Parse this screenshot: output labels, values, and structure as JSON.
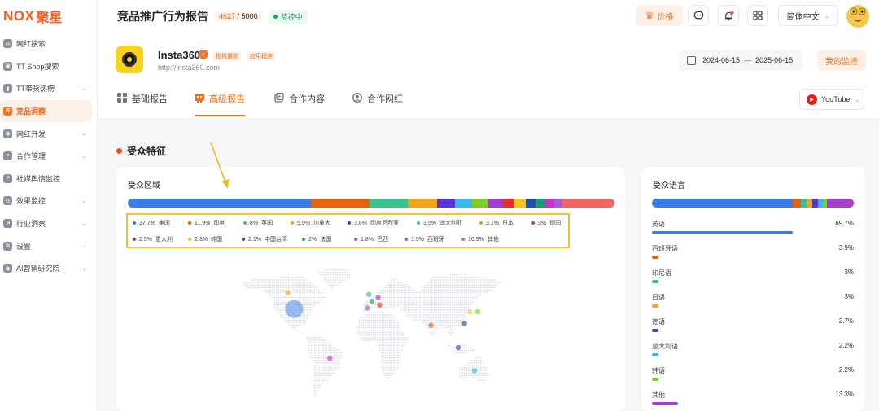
{
  "app": {
    "logo_text": "NOX",
    "logo_cn": "聚星"
  },
  "sidebar": {
    "items": [
      {
        "label": "网红搜索",
        "icon": "compass-icon",
        "chev": false,
        "active": false
      },
      {
        "label": "TT Shop搜索",
        "icon": "shop-icon",
        "chev": false,
        "active": false
      },
      {
        "label": "TT带货热榜",
        "icon": "bar-chart-icon",
        "chev": true,
        "active": false
      },
      {
        "label": "竞品洞察",
        "icon": "insight-icon",
        "chev": false,
        "active": true
      },
      {
        "label": "网红开发",
        "icon": "users-icon",
        "chev": true,
        "active": false
      },
      {
        "label": "合作管理",
        "icon": "document-icon",
        "chev": true,
        "active": false
      },
      {
        "label": "社媒舆情监控",
        "icon": "trend-icon",
        "chev": false,
        "active": false
      },
      {
        "label": "效果监控",
        "icon": "target-icon",
        "chev": true,
        "active": false
      },
      {
        "label": "行业洞察",
        "icon": "analytics-icon",
        "chev": true,
        "active": false
      },
      {
        "label": "设置",
        "icon": "gear-icon",
        "chev": true,
        "active": false
      },
      {
        "label": "AI营销研究院",
        "icon": "ai-icon",
        "chev": true,
        "active": false
      }
    ]
  },
  "header": {
    "title": "竞品推广行为报告",
    "quota_used": "4627",
    "quota_sep": " / ",
    "quota_total": "5000",
    "status": "监控中",
    "price_label": "价格",
    "lang_label": "简体中文"
  },
  "brand": {
    "name": "Insta360",
    "tag1": "相机摄影",
    "tag2": "应用程序",
    "url": "http://insta360.com",
    "date_start": "2024-06-15",
    "date_sep": "—",
    "date_end": "2025-06-15",
    "monitor_label": "我的监控"
  },
  "tabs": [
    {
      "label": "基础报告",
      "active": false
    },
    {
      "label": "高级报告",
      "active": true
    },
    {
      "label": "合作内容",
      "active": false
    },
    {
      "label": "合作网红",
      "active": false
    }
  ],
  "platform_select": "YouTube",
  "section_title": "受众特征",
  "region": {
    "title": "受众区域",
    "items": [
      {
        "pct": "37.7%",
        "name": "美国",
        "value": 37.7,
        "color": "#3b7de8"
      },
      {
        "pct": "11.9%",
        "name": "印度",
        "value": 11.9,
        "color": "#e2620f"
      },
      {
        "pct": "8%",
        "name": "英国",
        "value": 8,
        "color": "#3cc18a"
      },
      {
        "pct": "5.9%",
        "name": "加拿大",
        "value": 5.9,
        "color": "#f3a41f"
      },
      {
        "pct": "3.8%",
        "name": "印度尼西亚",
        "value": 3.8,
        "color": "#5a36d6"
      },
      {
        "pct": "3.5%",
        "name": "澳大利亚",
        "value": 3.5,
        "color": "#3bb7e8"
      },
      {
        "pct": "3.1%",
        "name": "日本",
        "value": 3.1,
        "color": "#7fcb2d"
      },
      {
        "pct": "3%",
        "name": "德国",
        "value": 3,
        "color": "#a63fd0"
      },
      {
        "pct": "2.5%",
        "name": "意大利",
        "value": 2.5,
        "color": "#e3312b"
      },
      {
        "pct": "2.3%",
        "name": "韩国",
        "value": 2.3,
        "color": "#f4c623"
      },
      {
        "pct": "2.1%",
        "name": "中国台湾",
        "value": 2.1,
        "color": "#274fa7"
      },
      {
        "pct": "2%",
        "name": "法国",
        "value": 2,
        "color": "#1c9b7a"
      },
      {
        "pct": "1.8%",
        "name": "巴西",
        "value": 1.8,
        "color": "#c437c1"
      },
      {
        "pct": "1.5%",
        "name": "西班牙",
        "value": 1.5,
        "color": "#9b5ce8"
      },
      {
        "pct": "10.9%",
        "name": "其他",
        "value": 10.9,
        "color": "#f06464"
      }
    ]
  },
  "language": {
    "title": "受众语言",
    "items": [
      {
        "name": "英语",
        "pct": "69.7%",
        "value": 69.7,
        "color": "#3b7de8"
      },
      {
        "name": "西班牙语",
        "pct": "3.9%",
        "value": 3.9,
        "color": "#e2620f"
      },
      {
        "name": "印尼语",
        "pct": "3%",
        "value": 3,
        "color": "#3cc18a"
      },
      {
        "name": "日语",
        "pct": "3%",
        "value": 3,
        "color": "#f3a41f"
      },
      {
        "name": "德语",
        "pct": "2.7%",
        "value": 2.7,
        "color": "#5a36d6"
      },
      {
        "name": "意大利语",
        "pct": "2.2%",
        "value": 2.2,
        "color": "#3bb7e8"
      },
      {
        "name": "韩语",
        "pct": "2.2%",
        "value": 2.2,
        "color": "#7fcb2d"
      },
      {
        "name": "其他",
        "pct": "13.3%",
        "value": 13.3,
        "color": "#a63fd0"
      }
    ]
  },
  "map_points": [
    {
      "lon": -98,
      "lat": 39,
      "value": 37.7,
      "color": "#3b7de8"
    },
    {
      "lon": -106,
      "lat": 56,
      "value": 5.9,
      "color": "#f3a41f"
    },
    {
      "lon": -2,
      "lat": 54,
      "value": 8,
      "color": "#3cc18a"
    },
    {
      "lon": 10,
      "lat": 51,
      "value": 3,
      "color": "#a63fd0"
    },
    {
      "lon": 12,
      "lat": 43,
      "value": 2.5,
      "color": "#e3312b"
    },
    {
      "lon": 2,
      "lat": 47,
      "value": 2,
      "color": "#1c9b7a"
    },
    {
      "lon": -4,
      "lat": 40,
      "value": 1.5,
      "color": "#9b5ce8"
    },
    {
      "lon": 78,
      "lat": 22,
      "value": 11.9,
      "color": "#e2620f"
    },
    {
      "lon": 138,
      "lat": 36,
      "value": 3.1,
      "color": "#7fcb2d"
    },
    {
      "lon": 128,
      "lat": 36,
      "value": 2.3,
      "color": "#f4c623"
    },
    {
      "lon": 121,
      "lat": 24,
      "value": 2.1,
      "color": "#274fa7"
    },
    {
      "lon": 113,
      "lat": -1,
      "value": 3.8,
      "color": "#5a36d6"
    },
    {
      "lon": 134,
      "lat": -25,
      "value": 3.5,
      "color": "#3bb7e8"
    },
    {
      "lon": -52,
      "lat": -12,
      "value": 1.8,
      "color": "#c437c1"
    }
  ]
}
